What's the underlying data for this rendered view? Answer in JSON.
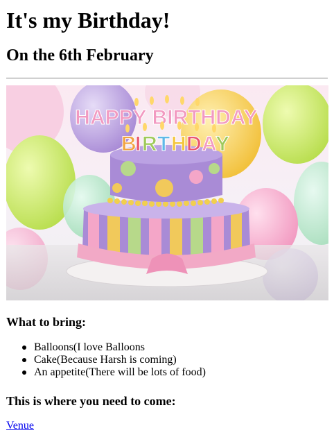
{
  "page": {
    "title": "It's my Birthday!",
    "subtitle": "On the 6th February"
  },
  "image": {
    "alt": "Birthday cake with candles",
    "candle_text": "HAPPY BIRTHDAY",
    "colors": {
      "cake_top": "#a98bd6",
      "cake_stripes": [
        "#f4a6c8",
        "#f1c95b",
        "#b7d98a",
        "#a98bd6"
      ],
      "ribbon": "#f2a9c6",
      "balloons": [
        "#c9e96b",
        "#b89ae0",
        "#f6c443",
        "#f29ac1",
        "#9fdcb6"
      ]
    }
  },
  "bring_section": {
    "heading": "What to bring:",
    "items": [
      "Balloons(I love Balloons",
      "Cake(Because Harsh is coming)",
      "An appetite(There will be lots of food)"
    ]
  },
  "venue_section": {
    "heading": "This is where you need to come:",
    "link_text": "Venue"
  }
}
